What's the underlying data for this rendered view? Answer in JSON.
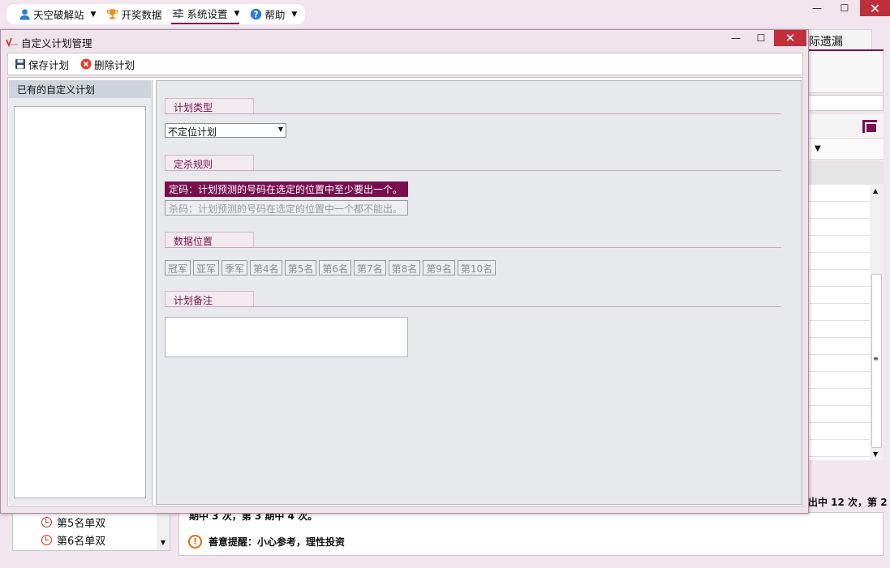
{
  "main_menu": {
    "items": [
      {
        "label": "天空破解站",
        "icon": "user-icon"
      },
      {
        "label": "开奖数据",
        "icon": "trophy-icon"
      },
      {
        "label": "系统设置",
        "icon": "sliders-icon"
      },
      {
        "label": "帮助",
        "icon": "help-icon"
      }
    ]
  },
  "main_window": {
    "minimize": "—",
    "maximize": "☐",
    "close": "✕"
  },
  "background": {
    "tab_label": "际遗漏",
    "right_text": "出中 12 次，第 2",
    "info_text": "期中 3 次，第 3 期中 4 次。",
    "tip_text": "善意提醒：小心参考，理性投资",
    "list_items": [
      "第5名单双",
      "第6名单双"
    ]
  },
  "dialog": {
    "title": "自定义计划管理",
    "minimize": "—",
    "maximize": "☐",
    "close": "✕",
    "toolbar": {
      "save_label": "保存计划",
      "delete_label": "删除计划"
    },
    "left_pane": {
      "header": "已有的自定义计划"
    },
    "plan_type": {
      "header": "计划类型",
      "selected": "不定位计划"
    },
    "rule": {
      "header": "定杀规则",
      "option_ding": "定码：计划预测的号码在选定的位置中至少要出一个。",
      "option_sha": "杀码：计划预测的号码在选定的位置中一个都不能出。"
    },
    "positions": {
      "header": "数据位置",
      "items": [
        "冠军",
        "亚军",
        "季军",
        "第4名",
        "第5名",
        "第6名",
        "第7名",
        "第8名",
        "第9名",
        "第10名"
      ]
    },
    "note": {
      "header": "计划备注",
      "value": ""
    }
  },
  "colors": {
    "accent": "#7a0d4e",
    "close_red": "#c0303a",
    "window_bg": "#f2e6ee"
  }
}
